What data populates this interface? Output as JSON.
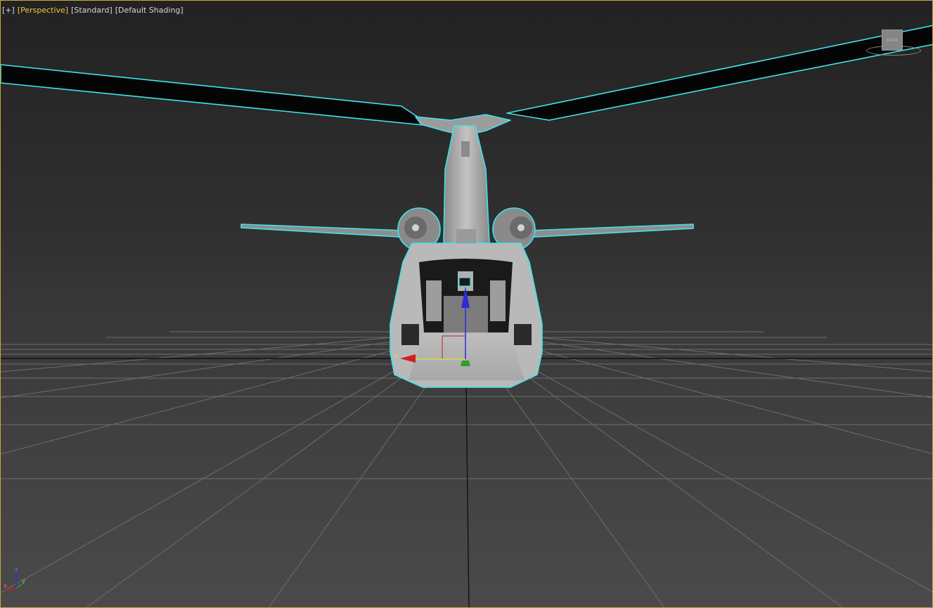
{
  "viewport": {
    "labels": {
      "plus": "[+]",
      "view": "[Perspective]",
      "style": "[Standard]",
      "shading": "[Default Shading]"
    },
    "viewcube": {
      "face_label": "BACK"
    },
    "axis_tripod": {
      "x": "x",
      "y": "y",
      "z": "z"
    },
    "gizmo": {
      "axis_label": "x"
    },
    "colors": {
      "selection_outline": "#3fe3f0",
      "active_label": "#f4c445",
      "border": "#c9a83c",
      "x_axis": "#d21f1f",
      "y_axis": "#2ca02c",
      "z_axis": "#2d2dd8"
    }
  }
}
